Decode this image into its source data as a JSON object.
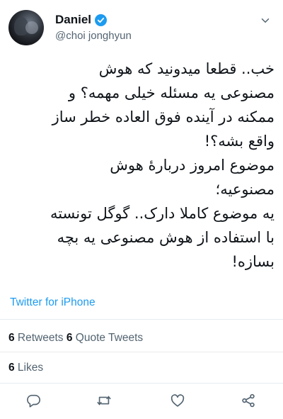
{
  "user": {
    "display_name": "Daniel",
    "handle": "@choi jonghyun",
    "verified": true
  },
  "tweet": {
    "lines": [
      "خب.. قطعا میدونید که هوش",
      "مصنوعی یه مسئله خیلی مهمه؟ و",
      "ممکنه در آینده فوق العاده خطر ساز",
      "واقع بشه؟!",
      "موضوع امروز دربارهٔ هوش",
      "مصنوعیه؛",
      "یه موضوع کاملا دارک.. گوگل تونسته",
      "با استفاده از هوش مصنوعی یه بچه",
      "بسازه!"
    ],
    "source": "Twitter for iPhone"
  },
  "stats": {
    "retweets_count": "6",
    "retweets_label": " Retweets ",
    "quote_count": "6",
    "quote_label": " Quote Tweets",
    "likes_count": "6",
    "likes_label": " Likes"
  },
  "actions": {
    "icons": [
      "reply-icon",
      "retweet-icon",
      "like-icon",
      "share-icon"
    ]
  },
  "colors": {
    "accent": "#1d9bf0",
    "text": "#0f1419",
    "muted": "#536471",
    "divider": "#e6ecf0"
  }
}
